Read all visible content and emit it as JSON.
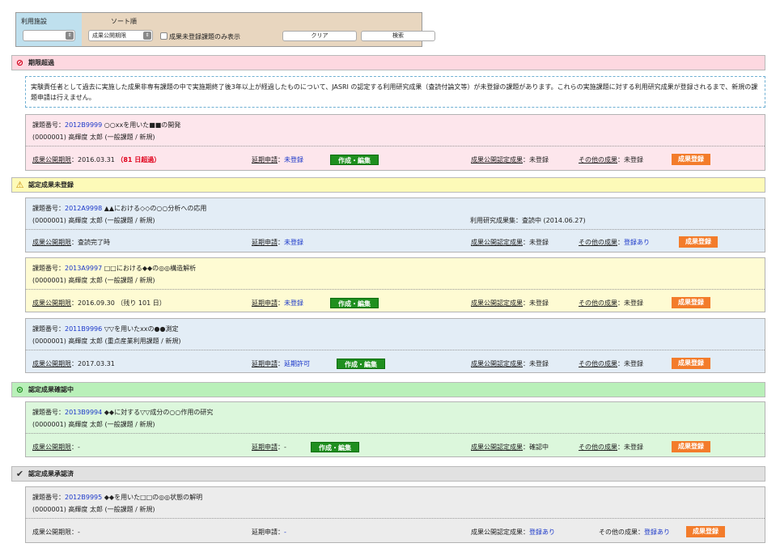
{
  "filter": {
    "facility_label": "利用施設",
    "sort_label": "ソート順",
    "facility_value": "",
    "sort_value": "成果公開期限",
    "only_unregistered_label": "成果未登録課題のみ表示",
    "clear_label": "クリア",
    "search_label": "検索"
  },
  "labels": {
    "project_no": "課題番号：",
    "deadline": "成果公開期限",
    "extension": "延期申請",
    "certified": "成果公開認定成果",
    "other": "その他の成果",
    "colon": "：",
    "edit_button": "作成・編集",
    "register_button": "成果登録"
  },
  "sections": [
    {
      "title": "期限超過",
      "icon": "prohibited-icon",
      "color": "#fdd8e0"
    },
    {
      "title": "認定成果未登録",
      "icon": "warning-icon",
      "color": "#fdfab8"
    },
    {
      "title": "認定成果確認中",
      "icon": "reviewing-icon",
      "color": "#b9f0b9"
    },
    {
      "title": "認定成果承認済",
      "icon": "check-icon",
      "color": "#e1e1e1"
    }
  ],
  "notice": "実験責任者として過去に実施した成果非専有課題の中で実施期終了後3年以上が経過したものについて、JASRI の認定する利用研究成果（査読付論文等）が未登録の課題があります。これらの実施課題に対する利用研究成果が登録されるまで、新規の課題申請は行えません。",
  "projects": [
    {
      "number": "2012B9999",
      "title": "○○xxを用いた■■の開発",
      "applicant": "(0000001) 高輝度 太郎 (一般課題 / 新規)",
      "extra": "",
      "deadline_value": "2016.03.31",
      "overdue": "（81 日超過）",
      "extension_value": "未登録",
      "certified_value": "未登録",
      "other_value": "未登録"
    },
    {
      "number": "2012A9998",
      "title": "▲▲における◇◇の○○分析への応用",
      "applicant": "(0000001) 高輝度 太郎 (一般課題 / 新規)",
      "extra": "利用研究成果集：査読中 (2014.06.27)",
      "deadline_value": "査読完了時",
      "overdue": "",
      "extension_value": "未登録",
      "certified_value": "未登録",
      "other_value": "登録あり"
    },
    {
      "number": "2013A9997",
      "title": "□□における◆◆の◎◎構造解析",
      "applicant": "(0000001) 高輝度 太郎 (一般課題 / 新規)",
      "extra": "",
      "deadline_value": "2016.09.30",
      "overdue": "（残り 101 日）",
      "extension_value": "未登録",
      "certified_value": "未登録",
      "other_value": "未登録"
    },
    {
      "number": "2011B9996",
      "title": "▽▽を用いたxxの●●測定",
      "applicant": "(0000001) 高輝度 太郎 (重点産業利用課題 / 新規)",
      "extra": "",
      "deadline_value": "2017.03.31",
      "overdue": "",
      "extension_value": "延期許可",
      "certified_value": "未登録",
      "other_value": "未登録"
    },
    {
      "number": "2013B9994",
      "title": "◆◆に対する▽▽成分の○○作用の研究",
      "applicant": "(0000001) 高輝度 太郎 (一般課題 / 新規)",
      "extra": "",
      "deadline_value": "-",
      "overdue": "",
      "extension_value": "-",
      "certified_value": "確認中",
      "other_value": "未登録"
    },
    {
      "number": "2012B9995",
      "title": "◆◆を用いた□□の◎◎状態の解明",
      "applicant": "(0000001) 高輝度 太郎 (一般課題 / 新規)",
      "extra": "",
      "deadline_value": "-",
      "overdue": "",
      "extension_value": "-",
      "certified_value": "登録あり",
      "other_value": "登録あり"
    }
  ]
}
